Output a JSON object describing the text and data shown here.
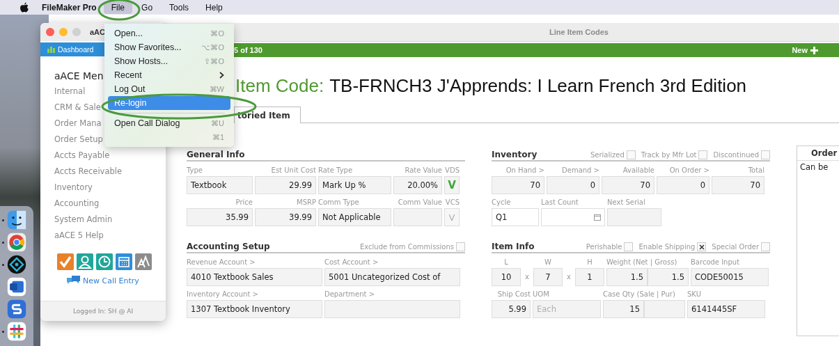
{
  "menu_bar": {
    "app_name": "FileMaker Pro",
    "items": [
      {
        "label": "File",
        "selected": true
      },
      {
        "label": "Go",
        "selected": false
      },
      {
        "label": "Tools",
        "selected": false
      },
      {
        "label": "Help",
        "selected": false
      }
    ]
  },
  "dock": {
    "apps": [
      {
        "kind": "finder",
        "running": true
      },
      {
        "kind": "browser",
        "running": true
      },
      {
        "kind": "filemaker",
        "running": true
      },
      {
        "kind": "word",
        "running": false
      },
      {
        "kind": "sapp",
        "running": false
      },
      {
        "kind": "slack",
        "running": true
      }
    ]
  },
  "main_window": {
    "title": "Line Item Codes",
    "record_count": "5 of 130",
    "new_button": "New",
    "heading_label": "Item Code:",
    "heading_value": "TB-FRNCH3 J'Apprends: I Learn French 3rd Edition",
    "tabs": [
      {
        "label": "toried Item",
        "selected": true
      }
    ],
    "columns": [
      {
        "sections": [
          {
            "title": "General Info",
            "rows": [
              {
                "fields": [
                  {
                    "label": "Type",
                    "kind": "text",
                    "value": "Textbook"
                  },
                  {
                    "label": "Est Unit Cost",
                    "kind": "number",
                    "value": "29.99"
                  },
                  {
                    "label": "Rate Type",
                    "kind": "text",
                    "value": "Mark Up %"
                  },
                  {
                    "label": "Rate Value",
                    "kind": "number",
                    "value": "20.00%"
                  },
                  {
                    "label": "VDS",
                    "kind": "toggle",
                    "value": "V"
                  }
                ]
              },
              {
                "fields": [
                  {
                    "label": "Price",
                    "kind": "number",
                    "value": "35.99"
                  },
                  {
                    "label": "MSRP",
                    "kind": "number",
                    "value": "39.99"
                  },
                  {
                    "label": "Comm Type",
                    "kind": "text",
                    "value": "Not Applicable"
                  },
                  {
                    "label": "Comm Value",
                    "kind": "number"
                  },
                  {
                    "label": "VCS",
                    "kind": "toggle",
                    "placeholder": "V"
                  }
                ]
              }
            ]
          },
          {
            "title": "Accounting Setup",
            "checks": [
              {
                "label": "Exclude from Commissions",
                "checked": false
              }
            ],
            "rows": [
              {
                "fields": [
                  {
                    "label": "Revenue Account >",
                    "kind": "text",
                    "value": "4010 Textbook Sales"
                  },
                  {
                    "label": "Cost Account >",
                    "kind": "text",
                    "value": "5001 Uncategorized Cost of"
                  }
                ]
              },
              {
                "fields": [
                  {
                    "label": "Inventory Account >",
                    "kind": "text",
                    "value": "1307 Textbook Inventory"
                  },
                  {
                    "label": "Department >",
                    "kind": "text"
                  }
                ]
              }
            ]
          }
        ]
      },
      {
        "sections": [
          {
            "title": "Inventory",
            "checks": [
              {
                "label": "Serialized",
                "checked": false
              },
              {
                "label": "Track by Mfr Lot",
                "checked": false
              },
              {
                "label": "Discontinued",
                "checked": false
              }
            ],
            "rows": [
              {
                "fields": [
                  {
                    "label": "On Hand >",
                    "kind": "count",
                    "value": "70"
                  },
                  {
                    "label": "Demand >",
                    "kind": "count",
                    "value": "0"
                  },
                  {
                    "label": "Available",
                    "kind": "count",
                    "value": "70"
                  },
                  {
                    "label": "On Order >",
                    "kind": "count",
                    "value": "0"
                  },
                  {
                    "label": "Total",
                    "kind": "count",
                    "value": "70"
                  }
                ]
              },
              {
                "fields": [
                  {
                    "label": "Cycle",
                    "kind": "input",
                    "value": "Q1"
                  },
                  {
                    "label": "Last Count",
                    "kind": "date"
                  },
                  {
                    "label": "Next Serial",
                    "kind": "text"
                  }
                ]
              }
            ]
          },
          {
            "title": "Item Info",
            "checks": [
              {
                "label": "Perishable",
                "checked": false
              },
              {
                "label": "Enable Shipping",
                "checked": true
              },
              {
                "label": "Special Order",
                "checked": false
              }
            ],
            "rows": [
              {
                "fields": [
                  {
                    "label": "L",
                    "kind": "dim",
                    "value": "10"
                  },
                  {
                    "kind": "sep",
                    "value": "x"
                  },
                  {
                    "label": "W",
                    "kind": "dim",
                    "value": "7"
                  },
                  {
                    "kind": "sep",
                    "value": "x"
                  },
                  {
                    "label": "H",
                    "kind": "dim",
                    "value": "1"
                  },
                  {
                    "label": "Weight (Net | Gross)",
                    "kind": "pair",
                    "values": [
                      "1.5",
                      "1.5"
                    ]
                  },
                  {
                    "label": "Barcode Input",
                    "kind": "text",
                    "value": "CODE50015"
                  }
                ]
              },
              {
                "fields": [
                  {
                    "label": "Ship Cost",
                    "kind": "number",
                    "value": "5.99"
                  },
                  {
                    "label": "UOM",
                    "kind": "text",
                    "placeholder": "Each"
                  },
                  {
                    "label": "Case Qty (Sale | Pur)",
                    "kind": "pair",
                    "values": [
                      "15"
                    ]
                  },
                  {
                    "label": "SKU",
                    "kind": "text",
                    "value": "6141445SF"
                  }
                ]
              }
            ]
          }
        ]
      }
    ],
    "side_panel": {
      "tab": "Order",
      "text": "Can be"
    }
  },
  "menu_panel": {
    "title": "aAC",
    "dashboard": "Dashboard",
    "heading": "aACE Men",
    "items": [
      "Internal",
      "CRM & Sale",
      "Order Mana",
      "Order Setup",
      "Accts Payable",
      "Accts Receivable",
      "Inventory",
      "Accounting",
      "System Admin",
      "aACE 5 Help"
    ],
    "quick_icons": [
      {
        "kind": "check",
        "color": "#e8812a"
      },
      {
        "kind": "person",
        "color": "#1fa79a"
      },
      {
        "kind": "clock",
        "color": "#1fa79a"
      },
      {
        "kind": "calendar",
        "color": "#2f8fd8"
      },
      {
        "kind": "font",
        "color": "#8c8c8c"
      }
    ],
    "call_link": "New Call Entry",
    "footer": "Logged In: SH @ AI"
  },
  "file_menu": {
    "items": [
      {
        "kind": "item",
        "label": "Open...",
        "shortcut": "⌘O",
        "selected": false
      },
      {
        "kind": "item",
        "label": "Show Favorites...",
        "shortcut": "⌥⌘O",
        "selected": false
      },
      {
        "kind": "item",
        "label": "Show Hosts...",
        "shortcut": "⇧⌘O",
        "selected": false
      },
      {
        "kind": "submenu",
        "label": "Recent",
        "selected": false
      },
      {
        "kind": "item",
        "label": "Log Out",
        "shortcut": "⌘W",
        "selected": false
      },
      {
        "kind": "item",
        "label": "Re-login",
        "selected": true
      },
      {
        "kind": "separator"
      },
      {
        "kind": "item",
        "label": "Open Call Dialog",
        "shortcut": "⌘U",
        "selected": false
      },
      {
        "kind": "item",
        "shortcut": "⌘1",
        "selected": false
      }
    ]
  },
  "annotations": [
    {
      "kind": "ellipse"
    },
    {
      "kind": "ellipse"
    }
  ]
}
